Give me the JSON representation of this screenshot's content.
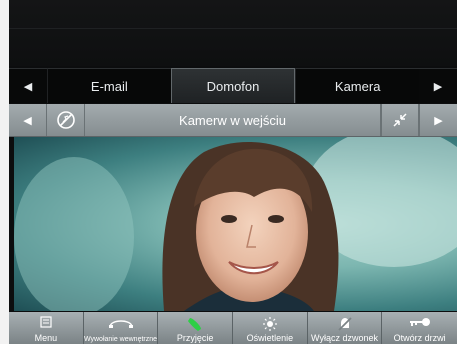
{
  "tabs": {
    "prev_icon": "arrow-left-icon",
    "items": [
      "E-mail",
      "Domofon",
      "Kamera"
    ],
    "active": "Domofon",
    "next_icon": "arrow-right-icon"
  },
  "camera_nav": {
    "title": "Kamerw w wejściu",
    "left_icons": [
      "arrow-left-icon",
      "no-entry-icon"
    ],
    "right_icons": [
      "collapse-icon",
      "arrow-right-icon"
    ]
  },
  "bottom_buttons": [
    {
      "label": "Menu",
      "icon": "menu-icon"
    },
    {
      "label": "Wywołanie wewnętrzne",
      "icon": "intercom-icon"
    },
    {
      "label": "Przyjęcie",
      "icon": "phone-icon"
    },
    {
      "label": "Oświetlenie",
      "icon": "light-icon"
    },
    {
      "label": "Wyłącz dzwonek",
      "icon": "bell-off-icon"
    },
    {
      "label": "Otwórz drzwi",
      "icon": "key-icon"
    }
  ],
  "colors": {
    "accent_green": "#2ecf46",
    "bar_gray": "#939b9e",
    "active_tab_border": "#62686b"
  }
}
